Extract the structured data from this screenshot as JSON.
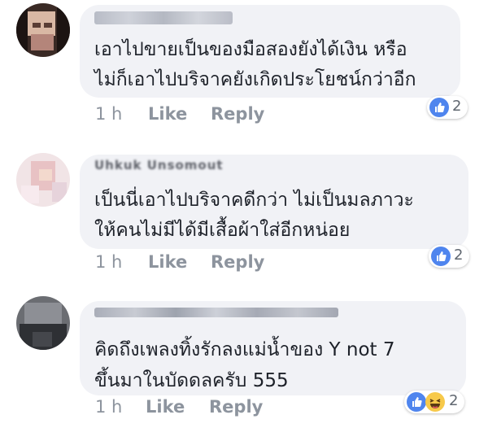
{
  "comments": [
    {
      "line1": "เอาไปขายเป็นของมือสองยังได้เงิน หรือ",
      "line2": "ไม่ก็เอาไปบริจาคยังเกิดประโยชน์กว่าอีก",
      "time": "1 h",
      "like_label": "Like",
      "reply_label": "Reply",
      "reaction_count": "2",
      "reactions": [
        "like-icon"
      ]
    },
    {
      "author_partial": "Uhkuk Unsomout",
      "line1": "เป็นนี่เอาไปบริจาคดีกว่า ไม่เป็นมลภาวะ",
      "line2": "ให้คนไม่มีได้มีเสื้อผ้าใส่อีกหน่อย",
      "time": "1 h",
      "like_label": "Like",
      "reply_label": "Reply",
      "reaction_count": "2",
      "reactions": [
        "like-icon"
      ]
    },
    {
      "line1": "คิดถึงเพลงทิ้งรักลงแม่น้ำของ Y not 7",
      "line2": "ขึ้นมาในบัดดลครับ 555",
      "time": "1 h",
      "like_label": "Like",
      "reply_label": "Reply",
      "reaction_count": "2",
      "reactions": [
        "like-icon",
        "haha-icon"
      ]
    }
  ],
  "colors": {
    "bubble": "#f1f2f6",
    "text": "#1d2129",
    "meta": "#8d949e",
    "like_blue": "#4f85ee",
    "haha_yellow": "#f7c94a"
  }
}
